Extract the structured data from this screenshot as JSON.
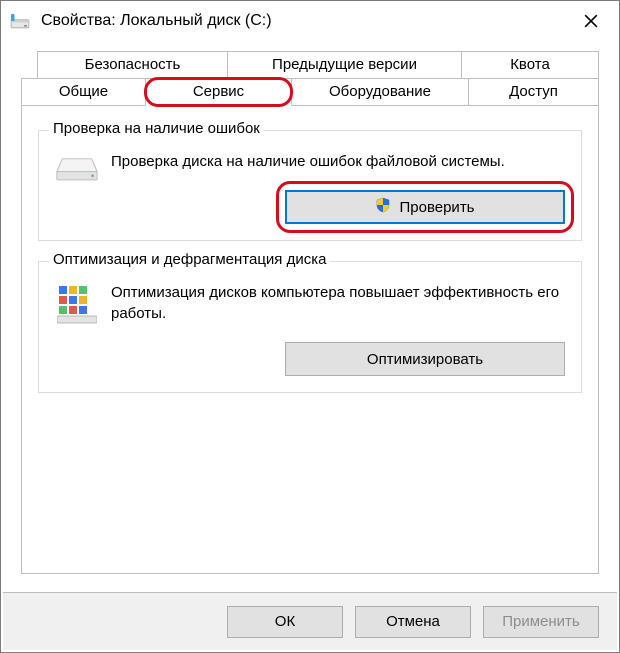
{
  "window": {
    "title": "Свойства: Локальный диск (C:)"
  },
  "tabs": {
    "row1": [
      {
        "label": "Безопасность"
      },
      {
        "label": "Предыдущие версии"
      },
      {
        "label": "Квота"
      }
    ],
    "row2": [
      {
        "label": "Общие"
      },
      {
        "label": "Сервис",
        "active": true
      },
      {
        "label": "Оборудование"
      },
      {
        "label": "Доступ"
      }
    ]
  },
  "group_check": {
    "legend": "Проверка на наличие ошибок",
    "desc": "Проверка диска на наличие ошибок файловой системы.",
    "button": "Проверить"
  },
  "group_opt": {
    "legend": "Оптимизация и дефрагментация диска",
    "desc": "Оптимизация дисков компьютера повышает эффективность его работы.",
    "button": "Оптимизировать"
  },
  "buttons": {
    "ok": "ОК",
    "cancel": "Отмена",
    "apply": "Применить"
  }
}
